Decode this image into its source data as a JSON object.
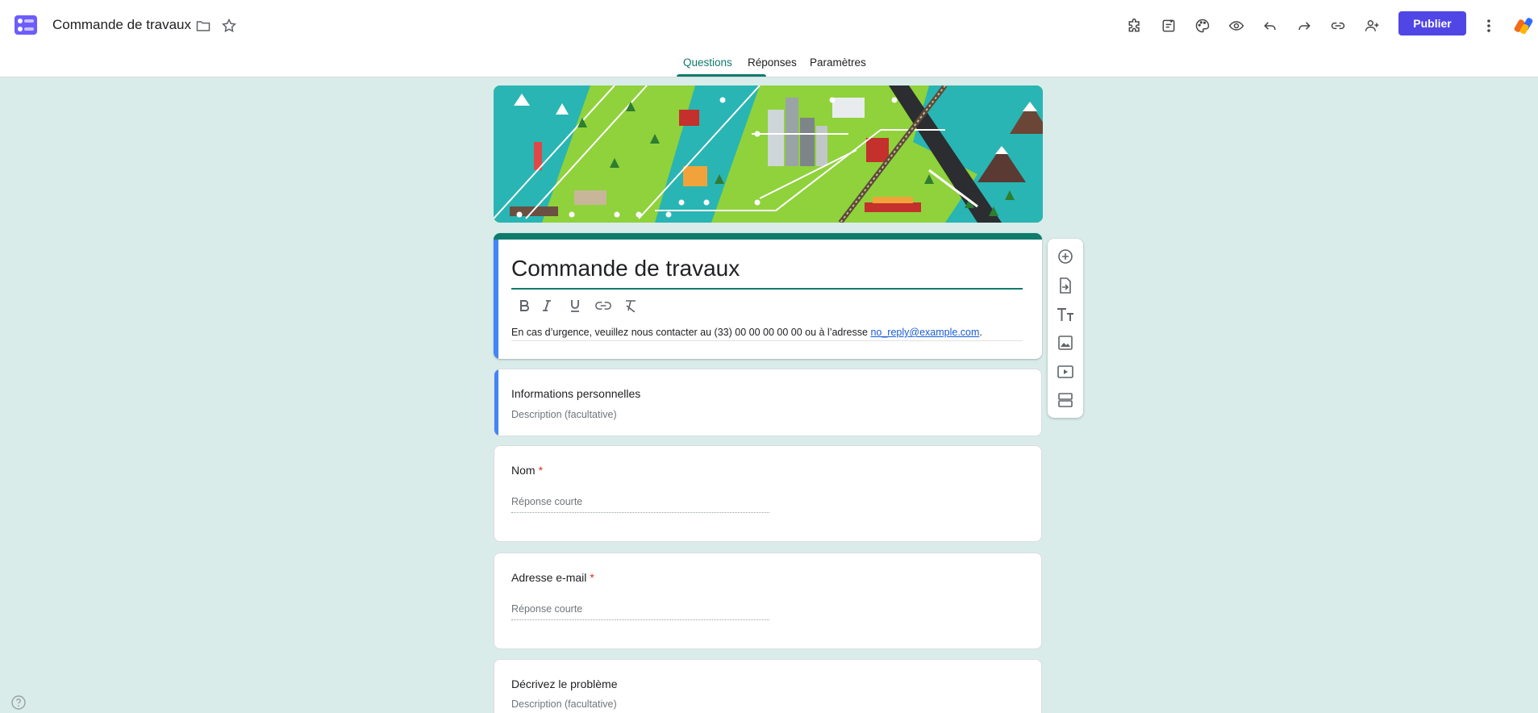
{
  "header": {
    "doc_title": "Commande de travaux",
    "publish_label": "Publier",
    "icons": [
      "forms-logo",
      "folder-icon",
      "star-icon",
      "addons-icon",
      "template-icon",
      "palette-icon",
      "preview-eye-icon",
      "undo-icon",
      "redo-icon",
      "link-icon",
      "add-collaborator-icon",
      "more-vert-icon"
    ],
    "accent_color": "#4f46e5"
  },
  "tabs": [
    {
      "label": "Questions",
      "active": true
    },
    {
      "label": "Réponses",
      "active": false
    },
    {
      "label": "Paramètres",
      "active": false
    }
  ],
  "form": {
    "title": "Commande de travaux",
    "description_prefix": "En cas d’urgence, veuillez nous contacter au (33) 00 00 00 00 00 ou à l’adresse ",
    "description_email": "no_reply@example.com",
    "description_suffix": ".",
    "theme_color": "#0f7b6c",
    "format_tools": [
      "bold-icon",
      "italic-icon",
      "underline-icon",
      "link-icon",
      "clear-format-icon"
    ]
  },
  "section": {
    "title": "Informations personnelles",
    "description_placeholder": "Description (facultative)"
  },
  "questions": [
    {
      "title": "Nom",
      "required": true,
      "required_mark": "*",
      "answer_placeholder": "Réponse courte"
    },
    {
      "title": "Adresse e-mail",
      "required": true,
      "required_mark": "*",
      "answer_placeholder": "Réponse courte"
    },
    {
      "title": "Décrivez le problème",
      "required": false,
      "description_placeholder": "Description (facultative)"
    }
  ],
  "side_toolbar": [
    "add-question-icon",
    "import-questions-icon",
    "add-title-icon",
    "add-image-icon",
    "add-video-icon",
    "add-section-icon"
  ]
}
